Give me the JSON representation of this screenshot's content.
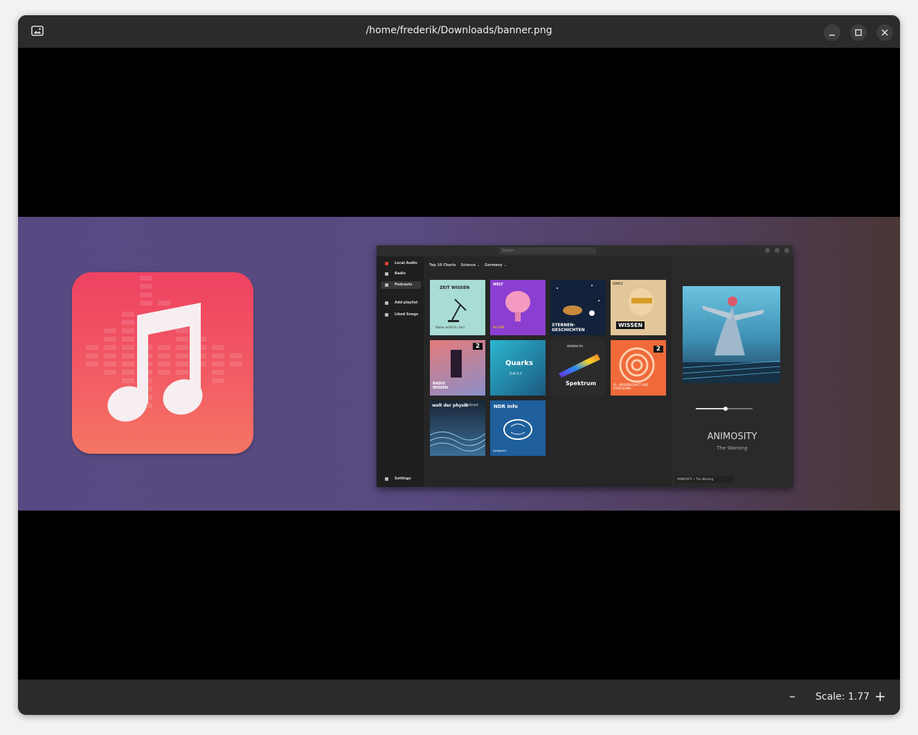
{
  "window": {
    "title": "/home/frederik/Downloads/banner.png",
    "icons": {
      "app": "image-viewer-icon",
      "minimize": "minimize-icon",
      "maximize": "maximize-icon",
      "close": "close-icon"
    }
  },
  "image": {
    "app_logo_icon": "music-note-icon",
    "screenshot": {
      "search_placeholder": "Search",
      "sidebar": [
        "Local Audio",
        "Radio",
        "Podcasts",
        "Add playlist",
        "Liked Songs"
      ],
      "sidebar_selected": "Podcasts",
      "settings_label": "Settings",
      "filter": [
        "Top 10 Charts",
        "Science",
        "Germany"
      ],
      "tiles": [
        {
          "label": "ZEIT WISSEN",
          "sub": "Woher weißt Du das?"
        },
        {
          "label": "WELT",
          "sub": "AI-LAB"
        },
        {
          "label": "STERNEN-GESCHICHTEN",
          "sub": ""
        },
        {
          "label": "WISSEN",
          "sub": "SWR2"
        },
        {
          "label": "RADIO WISSEN",
          "sub": "2"
        },
        {
          "label": "Quarks",
          "sub": "DAILY"
        },
        {
          "label": "Spektrum",
          "sub": "detektor.fm"
        },
        {
          "label": "IQ - WISSENSCHAFT UND FORSCHUNG",
          "sub": "2"
        },
        {
          "label": "welt der physik",
          "sub": "podcast"
        },
        {
          "label": "NDR Info",
          "sub": "synapsen"
        }
      ],
      "now_playing": {
        "title": "ANIMOSITY",
        "artist": "The Warning"
      },
      "footer_track": "ANIMOSITY • The Warning"
    }
  },
  "status": {
    "zoom_out_label": "–",
    "scale_text": "Scale: 1.77",
    "zoom_in_label": "+"
  },
  "colors": {
    "titlebar": "#2b2b2b",
    "banner_left": "#574a82",
    "banner_right": "#493636",
    "logo_top": "#ee4262",
    "logo_bottom": "#f57665"
  }
}
